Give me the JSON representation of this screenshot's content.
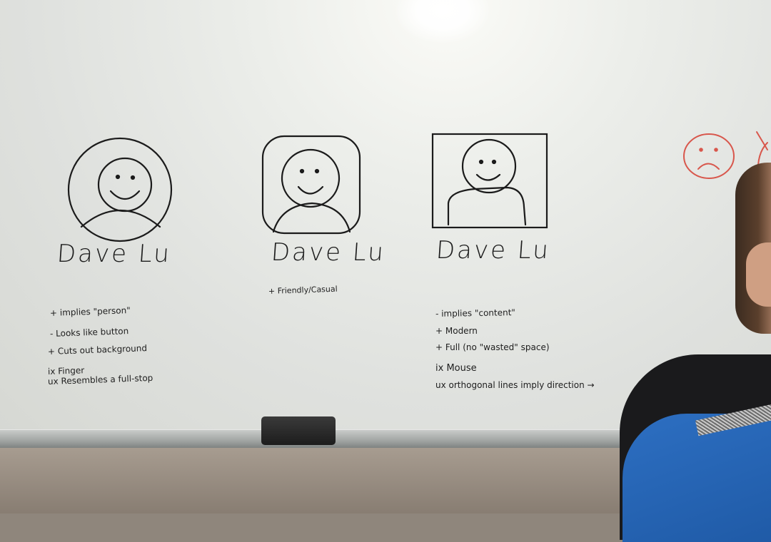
{
  "board": {
    "sketches": [
      {
        "shape": "circle",
        "name": "Dave Lu",
        "notes": [
          "+ implies \"person\"",
          "- Looks like button",
          "+ Cuts out background",
          "ix Finger",
          "ux Resembles a full-stop"
        ]
      },
      {
        "shape": "rounded-square",
        "name": "Dave Lu",
        "notes": [
          "+ Friendly/Casual"
        ]
      },
      {
        "shape": "square",
        "name": "Dave Lu",
        "notes": [
          "- implies \"content\"",
          "+ Modern",
          "+ Full (no \"wasted\" space)",
          "ix Mouse",
          "ux orthogonal lines imply direction →"
        ]
      }
    ],
    "partial_sketch_icon": "sad-face-icon",
    "ink_colors": {
      "marker": "#1b1b1b",
      "red_marker": "#d8574c"
    }
  }
}
